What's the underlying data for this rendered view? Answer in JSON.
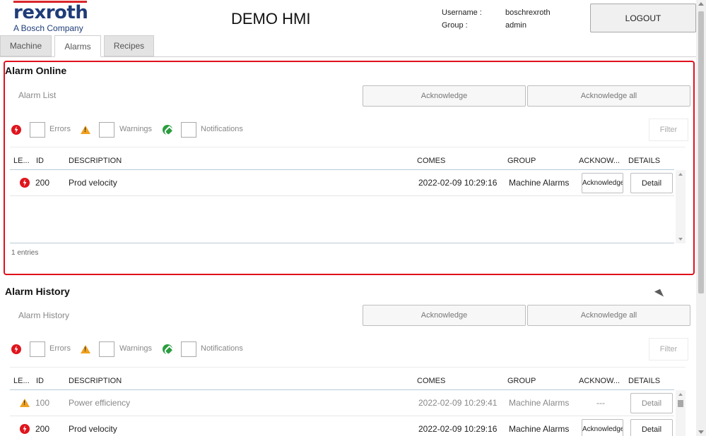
{
  "header": {
    "logo_name": "rexroth",
    "logo_sub": "A Bosch Company",
    "title": "DEMO HMI",
    "username_label": "Username :",
    "username_value": "boschrexroth",
    "group_label": "Group :",
    "group_value": "admin",
    "logout_label": "LOGOUT"
  },
  "tabs": [
    {
      "label": "Machine",
      "active": false
    },
    {
      "label": "Alarms",
      "active": true
    },
    {
      "label": "Recipes",
      "active": false
    }
  ],
  "colors": {
    "error": "#e0141c",
    "warning": "#f0a01e",
    "notification": "#2a9d3f",
    "highlight": "#e0101c",
    "brand": "#1f3c78"
  },
  "filters": {
    "errors": "Errors",
    "warnings": "Warnings",
    "notifications": "Notifications",
    "filter_button": "Filter"
  },
  "columns": {
    "level": "LE...",
    "id": "ID",
    "description": "DESCRIPTION",
    "comes": "COMES",
    "group": "GROUP",
    "acknowledge": "ACKNOW...",
    "details": "DETAILS"
  },
  "alarm_online": {
    "title": "Alarm Online",
    "list_title": "Alarm List",
    "acknowledge_label": "Acknowledge",
    "acknowledge_all_label": "Acknowledge all",
    "rows": [
      {
        "level_icon": "error-icon",
        "id": "200",
        "description": "Prod velocity",
        "comes": "2022-02-09 10:29:16",
        "group": "Machine Alarms",
        "ack": "Acknowledge",
        "details": "Detail"
      }
    ],
    "entries": "1 entries"
  },
  "alarm_history": {
    "title": "Alarm History",
    "list_title": "Alarm History",
    "acknowledge_label": "Acknowledge",
    "acknowledge_all_label": "Acknowledge all",
    "rows": [
      {
        "level_icon": "warning-icon",
        "id": "100",
        "description": "Power efficiency",
        "comes": "2022-02-09 10:29:41",
        "group": "Machine Alarms",
        "ack": "---",
        "details": "Detail"
      },
      {
        "level_icon": "error-icon",
        "id": "200",
        "description": "Prod velocity",
        "comes": "2022-02-09 10:29:16",
        "group": "Machine Alarms",
        "ack": "Acknowledge",
        "details": "Detail"
      }
    ]
  }
}
